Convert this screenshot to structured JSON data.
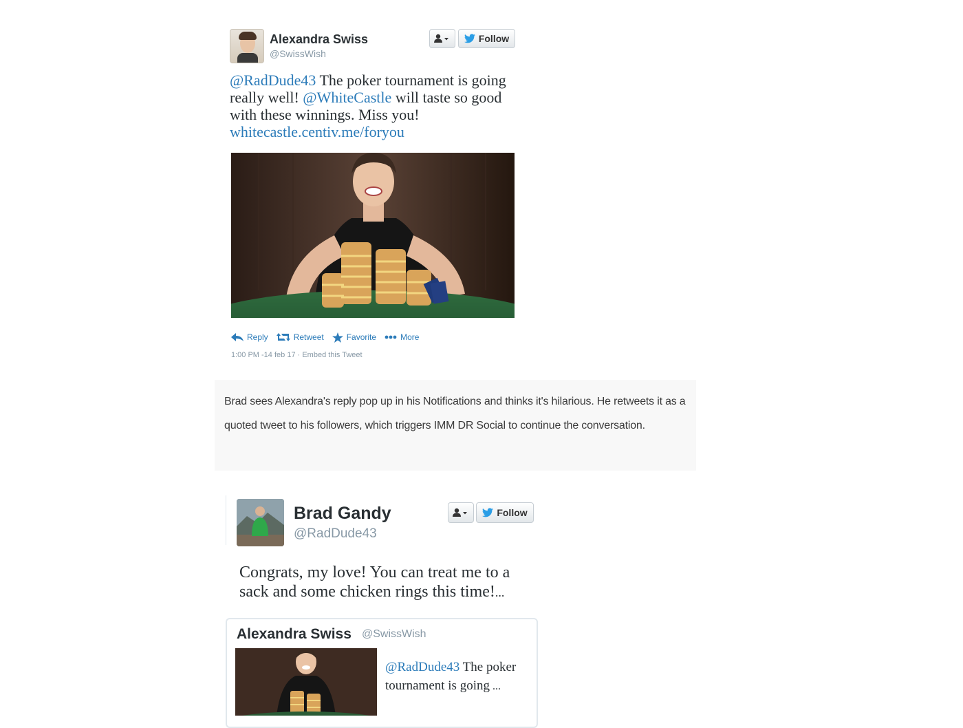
{
  "tweet1": {
    "author_name": "Alexandra Swiss",
    "author_handle": "@SwissWish",
    "follow_label": "Follow",
    "text": {
      "mention1": "@RadDude43",
      "part1": " The poker tournament is going really well! ",
      "mention2": "@WhiteCastle",
      "part2": " will taste so good with these winnings. Miss you! ",
      "link": "whitecastle.centiv.me/foryou"
    },
    "actions": {
      "reply": "Reply",
      "retweet": "Retweet",
      "favorite": "Favorite",
      "more": "More"
    },
    "timestamp": "1:00 PM -14 feb 17",
    "embed_label": "· Embed this Tweet"
  },
  "caption": "Brad sees Alexandra's reply pop up in his Notifications and thinks it's hilarious. He retweets it as a quoted tweet to his followers, which triggers IMM DR Social to continue the conversation.",
  "tweet2": {
    "author_name": "Brad Gandy",
    "author_handle": "@RadDude43",
    "follow_label": "Follow",
    "text": "Congrats, my love! You can treat me to a sack and some chicken rings this time!",
    "ellipsis": "...",
    "quoted": {
      "author_name": "Alexandra Swiss",
      "author_handle": "@SwissWish",
      "mention": "@RadDude43",
      "text": " The poker tournament is going",
      "ellipsis": " ..."
    }
  },
  "colors": {
    "link": "#2b7bb9",
    "muted": "#8899a6",
    "caption_bg": "#f8f8f8",
    "twitter_blue": "#1da1f2"
  }
}
